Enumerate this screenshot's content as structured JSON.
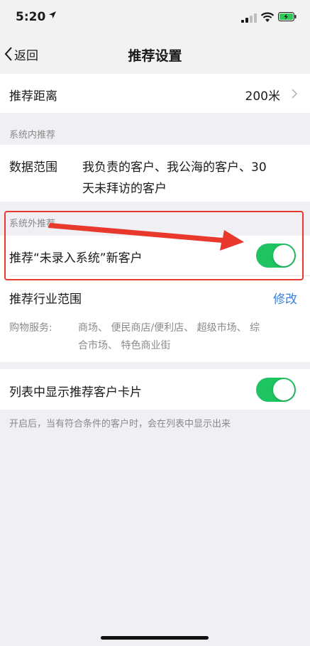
{
  "status": {
    "time": "5:20"
  },
  "nav": {
    "back_label": "返回",
    "title": "推荐设置"
  },
  "distance": {
    "label": "推荐距离",
    "value": "200米"
  },
  "internal": {
    "header": "系统内推荐",
    "scope_label": "数据范围",
    "scope_line1": "我负责的客户、我公海的客户、30",
    "scope_line2": "天未拜访的客户"
  },
  "external": {
    "header": "系统外推荐",
    "toggle_label": "推荐“未录入系统”新客户",
    "toggle_on": true,
    "industry_label": "推荐行业范围",
    "industry_action": "修改",
    "category_label": "购物服务:",
    "category_line1": "商场、 便民商店/便利店、 超级市场、 综",
    "category_line2": "合市场、 特色商业街"
  },
  "card": {
    "label": "列表中显示推荐客户卡片",
    "toggle_on": true,
    "note": "开启后，当有符合条件的客户时，会在列表中显示出来"
  },
  "colors": {
    "toggle_on": "#1fc462",
    "link": "#3b7fd9",
    "highlight": "#e8392c"
  }
}
